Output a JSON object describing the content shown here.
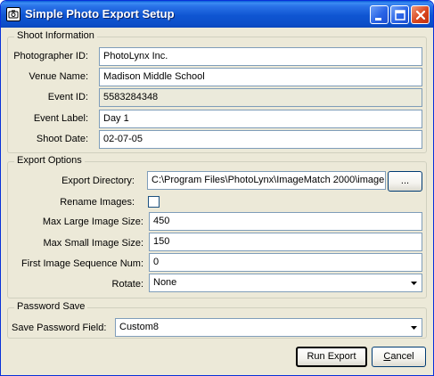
{
  "window": {
    "title": "Simple Photo Export Setup"
  },
  "shoot_information": {
    "legend": "Shoot Information",
    "photographer_id_label": "Photographer ID:",
    "photographer_id": "PhotoLynx Inc.",
    "venue_name_label": "Venue Name:",
    "venue_name": "Madison Middle School",
    "event_id_label": "Event ID:",
    "event_id": "5583284348",
    "event_label_label": "Event Label:",
    "event_label": "Day 1",
    "shoot_date_label": "Shoot Date:",
    "shoot_date": "02-07-05"
  },
  "export_options": {
    "legend": "Export Options",
    "export_directory_label": "Export Directory:",
    "export_directory": "C:\\Program Files\\PhotoLynx\\ImageMatch 2000\\image",
    "browse_label": "...",
    "rename_images_label": "Rename Images:",
    "rename_images_checked": false,
    "max_large_label": "Max Large Image Size:",
    "max_large": "450",
    "max_small_label": "Max Small Image Size:",
    "max_small": "150",
    "first_seq_label": "First Image Sequence Num:",
    "first_seq": "0",
    "rotate_label": "Rotate:",
    "rotate": "None"
  },
  "password_save": {
    "legend": "Password Save",
    "field_label": "Save Password Field:",
    "field": "Custom8"
  },
  "buttons": {
    "run_export": "Run Export",
    "cancel_underlined": "C",
    "cancel_rest": "ancel"
  },
  "icons": {
    "app": "camera-icon",
    "minimize": "minimize-icon",
    "maximize": "maximize-icon",
    "close": "close-icon",
    "dropdown": "chevron-down-icon"
  },
  "colors": {
    "title_bar": "#0c4fc9",
    "close_button": "#d9461f",
    "dialog_bg": "#ece9d8",
    "field_border": "#7f9db9"
  }
}
